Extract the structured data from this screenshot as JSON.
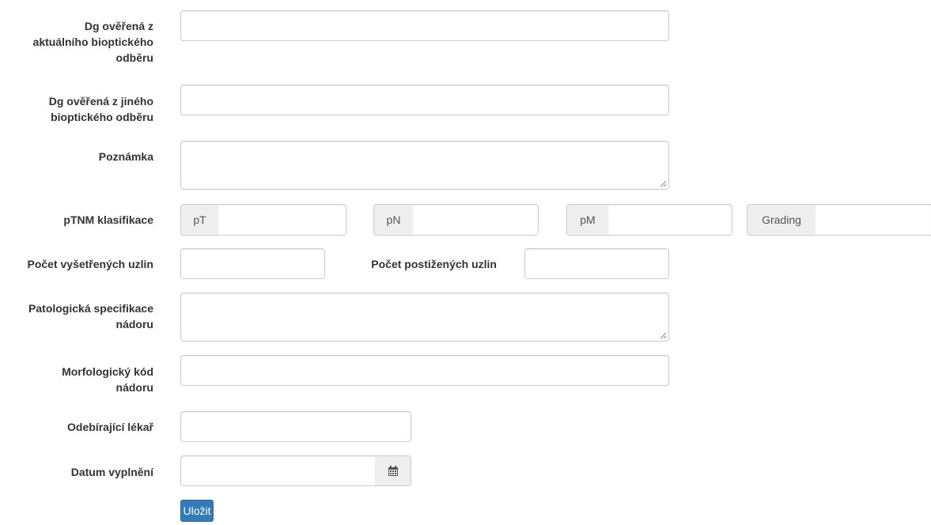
{
  "form": {
    "dg_current_label_1": "Dg ověřená z",
    "dg_current_label_2": "aktuálního bioptického",
    "dg_current_label_3": "odběru",
    "dg_other_label_1": "Dg ověřená z jiného",
    "dg_other_label_2": "bioptického odběru",
    "note_label": "Poznámka",
    "ptnm_label": "pTNM klasifikace",
    "pt_addon": "pT",
    "pn_addon": "pN",
    "pm_addon": "pM",
    "grading_addon": "Grading",
    "nodes_examined_label": "Počet vyšetřených uzlin",
    "nodes_affected_label": "Počet postižených uzlin",
    "patho_spec_label_1": "Patologická specifikace",
    "patho_spec_label_2": "nádoru",
    "morph_code_label_1": "Morfologický kód",
    "morph_code_label_2": "nádoru",
    "doctor_label": "Odebírající lékař",
    "date_label": "Datum vyplnění",
    "save_button": "Uložit"
  },
  "icons": {
    "calendar": "calendar-icon",
    "resize": "resize-grip-icon"
  },
  "colors": {
    "primary": "#337ab7",
    "addon_bg": "#eeeeee",
    "border": "#cccccc"
  }
}
